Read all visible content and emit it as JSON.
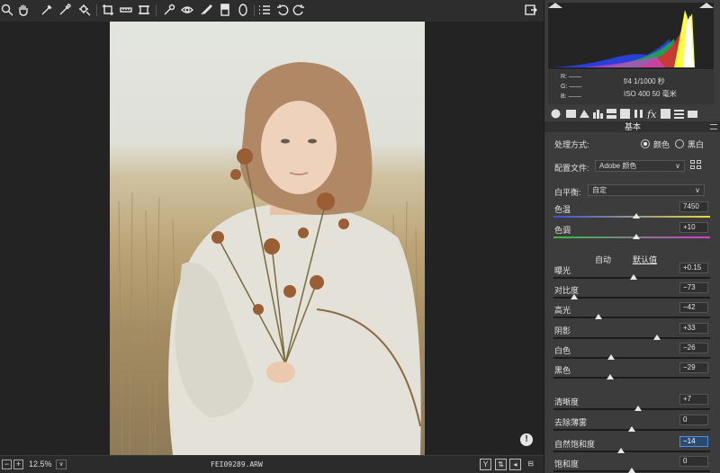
{
  "toolbar": {
    "tools": [
      "zoom-icon",
      "hand-icon",
      "white-balance-icon",
      "color-sampler-icon",
      "target-adjust-icon",
      "crop-icon",
      "straighten-icon",
      "transform-icon",
      "spot-removal-icon",
      "red-eye-icon",
      "adjustment-brush-icon",
      "graduated-filter-icon",
      "radial-filter-icon",
      "presets-icon",
      "rotate-left-icon",
      "rotate-right-icon"
    ]
  },
  "camera_info": {
    "r_label": "R:",
    "g_label": "G:",
    "b_label": "B:",
    "rgb_placeholder": "——",
    "aperture_shutter": "f/4  1/1000 秒",
    "iso_focal": "ISO 400  50 毫米"
  },
  "panel": {
    "section_title": "基本",
    "treatment_label": "处理方式:",
    "treatment_options": [
      "颜色",
      "黑白"
    ],
    "treatment_selected": "颜色",
    "profile_label": "配置文件:",
    "profile_value": "Adobe 颜色",
    "wb_label": "白平衡:",
    "wb_value": "自定",
    "auto_label": "自动",
    "default_label": "默认值",
    "sliders": [
      {
        "key": "temp",
        "label": "色温",
        "value": "7450",
        "pos": 0.53,
        "track": "temp"
      },
      {
        "key": "tint",
        "label": "色调",
        "value": "+10",
        "pos": 0.53,
        "track": "tint"
      },
      {
        "key": "exposure",
        "label": "曝光",
        "value": "+0.15",
        "pos": 0.51,
        "track": "plain"
      },
      {
        "key": "contrast",
        "label": "对比度",
        "value": "−73",
        "pos": 0.13,
        "track": "plain"
      },
      {
        "key": "highlights",
        "label": "高光",
        "value": "−42",
        "pos": 0.29,
        "track": "plain"
      },
      {
        "key": "shadows",
        "label": "阴影",
        "value": "+33",
        "pos": 0.66,
        "track": "plain"
      },
      {
        "key": "whites",
        "label": "白色",
        "value": "−26",
        "pos": 0.37,
        "track": "plain"
      },
      {
        "key": "blacks",
        "label": "黑色",
        "value": "−29",
        "pos": 0.36,
        "track": "plain"
      },
      {
        "key": "clarity",
        "label": "清晰度",
        "value": "+7",
        "pos": 0.54,
        "track": "plain"
      },
      {
        "key": "dehaze",
        "label": "去除薄雾",
        "value": "0",
        "pos": 0.5,
        "track": "plain"
      },
      {
        "key": "vibrance",
        "label": "自然饱和度",
        "value": "−14",
        "pos": 0.43,
        "track": "plain",
        "active": true
      },
      {
        "key": "saturation",
        "label": "饱和度",
        "value": "0",
        "pos": 0.5,
        "track": "plain"
      }
    ]
  },
  "bottom": {
    "zoom": "12.5%",
    "filename": "FEI09289.ARW",
    "right_buttons": [
      "Y",
      "⇅",
      "◂",
      "⊟"
    ]
  },
  "colors": {
    "panel_bg": "#3c3c3c",
    "accent": "#4a8fe0",
    "canvas_bg": "#232323"
  }
}
